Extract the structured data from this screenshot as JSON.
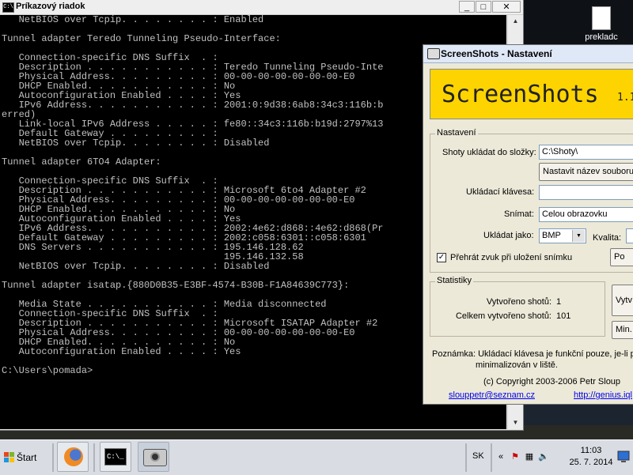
{
  "desktop": {
    "icon_label": "prekladc"
  },
  "cmd_window": {
    "title": "Príkazový riadok",
    "icon_text": "C:\\",
    "buttons": {
      "minimize": "_",
      "maximize": "□",
      "close": "✕"
    },
    "lines": [
      "   NetBIOS over Tcpip. . . . . . . . : Enabled",
      "",
      "Tunnel adapter Teredo Tunneling Pseudo-Interface:",
      "",
      "   Connection-specific DNS Suffix  . :",
      "   Description . . . . . . . . . . . : Teredo Tunneling Pseudo-Inte",
      "   Physical Address. . . . . . . . . : 00-00-00-00-00-00-00-E0",
      "   DHCP Enabled. . . . . . . . . . . : No",
      "   Autoconfiguration Enabled . . . . : Yes",
      "   IPv6 Address. . . . . . . . . . . : 2001:0:9d38:6ab8:34c3:116b:b",
      "erred)",
      "   Link-local IPv6 Address . . . . . : fe80::34c3:116b:b19d:2797%13",
      "   Default Gateway . . . . . . . . . :",
      "   NetBIOS over Tcpip. . . . . . . . : Disabled",
      "",
      "Tunnel adapter 6TO4 Adapter:",
      "",
      "   Connection-specific DNS Suffix  . :",
      "   Description . . . . . . . . . . . : Microsoft 6to4 Adapter #2",
      "   Physical Address. . . . . . . . . : 00-00-00-00-00-00-00-E0",
      "   DHCP Enabled. . . . . . . . . . . : No",
      "   Autoconfiguration Enabled . . . . : Yes",
      "   IPv6 Address. . . . . . . . . . . : 2002:4e62:d868::4e62:d868(Pr",
      "   Default Gateway . . . . . . . . . : 2002:c058:6301::c058:6301",
      "   DNS Servers . . . . . . . . . . . : 195.146.128.62",
      "                                       195.146.132.58",
      "   NetBIOS over Tcpip. . . . . . . . : Disabled",
      "",
      "Tunnel adapter isatap.{880D0B35-E3BF-4574-B30B-F1A84639C773}:",
      "",
      "   Media State . . . . . . . . . . . : Media disconnected",
      "   Connection-specific DNS Suffix  . :",
      "   Description . . . . . . . . . . . : Microsoft ISATAP Adapter #2",
      "   Physical Address. . . . . . . . . : 00-00-00-00-00-00-00-E0",
      "   DHCP Enabled. . . . . . . . . . . : No",
      "   Autoconfiguration Enabled . . . . : Yes",
      "",
      "C:\\Users\\pomada>"
    ]
  },
  "screenshots_window": {
    "title": "ScreenShots - Nastavení",
    "banner_name": "ScreenShots",
    "banner_version": "1.1",
    "settings": {
      "legend": "Nastavení",
      "folder_label": "Shoty ukládat do složky:",
      "folder_value": "C:\\Shoty\\",
      "filename_button": "Nastavit název souboru",
      "hotkey_label": "Ukládací klávesa:",
      "hotkey_value": "",
      "capture_label": "Snímat:",
      "capture_value": "Celou obrazovku",
      "format_label": "Ukládat jako:",
      "format_value": "BMP",
      "quality_label": "Kvalita:",
      "sound_label": "Přehrát zvuk při uložení snímku",
      "sound_checked": "✓",
      "right_button": "Po"
    },
    "stats": {
      "legend": "Statistiky",
      "created_label": "Vytvořeno shotů:",
      "created_value": "1",
      "total_label": "Celkem vytvořeno shotů:",
      "total_value": "101",
      "button1": "Vytv",
      "button2": "Min."
    },
    "note_line1": "Poznámka: Ukládací klávesa je funkční pouze, je-li pr",
    "note_line2": "minimalizován v liště.",
    "copyright": "(c) Copyright 2003-2006 Petr Sloup",
    "email": "slouppetr@seznam.cz",
    "url": "http://genius.iql"
  },
  "taskbar": {
    "start_label": "Štart",
    "language": "SK",
    "time": "11:03",
    "date": "25. 7. 2014",
    "tray_chevron": "«",
    "cmd_icon_text": "C:\\_"
  },
  "colors": {
    "banner": "#fdd400",
    "console_bg": "#000000",
    "console_text": "#c0c0c0",
    "link": "#0000ee"
  }
}
